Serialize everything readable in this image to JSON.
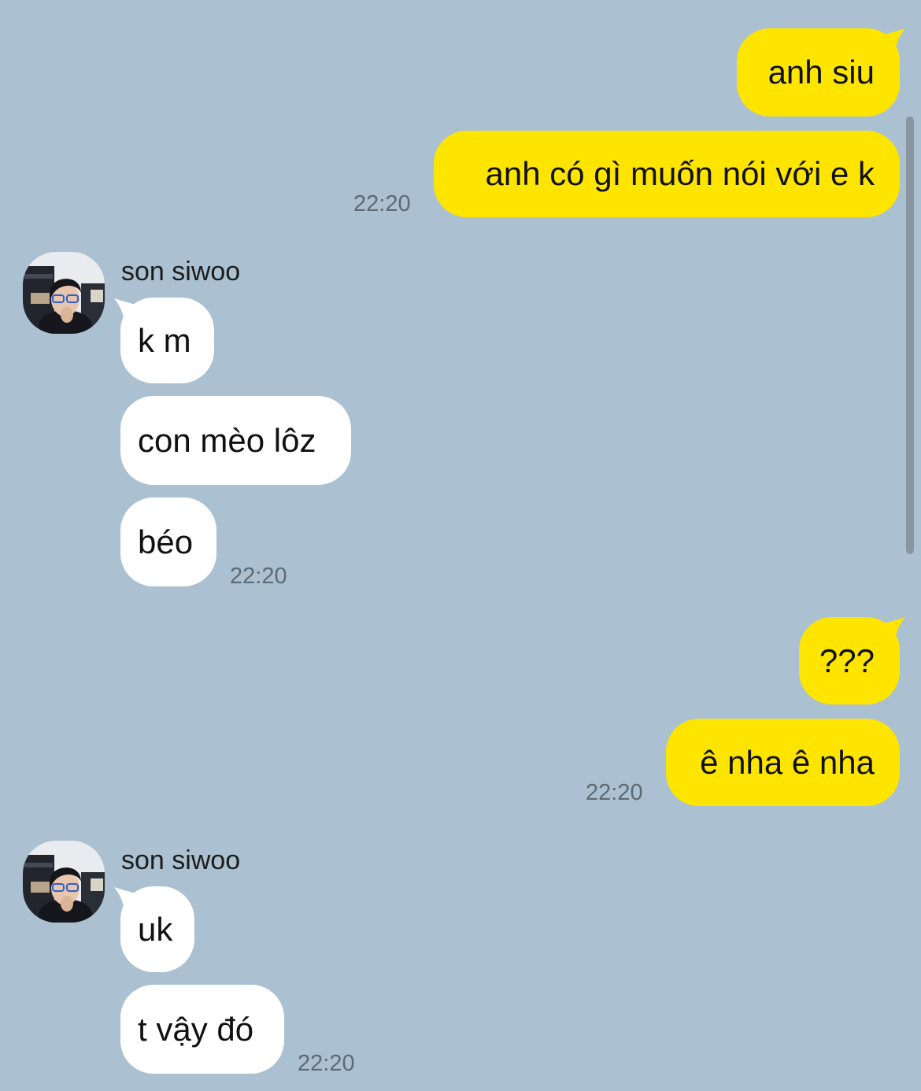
{
  "chat": {
    "sender_name": "son siwoo",
    "messages": [
      {
        "text": "anh siu"
      },
      {
        "text": "anh có gì muốn nói với e k"
      },
      {
        "text": "k m"
      },
      {
        "text": "con mèo lôz"
      },
      {
        "text": "béo"
      },
      {
        "text": "???"
      },
      {
        "text": "ê nha ê nha"
      },
      {
        "text": "uk"
      },
      {
        "text": "t vậy đó"
      }
    ],
    "timestamps": [
      "22:20",
      "22:20",
      "22:20",
      "22:20"
    ]
  },
  "colors": {
    "background": "#abc1d1",
    "outgoing_bubble": "#fee500",
    "incoming_bubble": "#ffffff",
    "timestamp": "#5d6a75"
  },
  "icons": {
    "avatar": "profile-photo",
    "scrollbar": "scrollbar-thumb"
  }
}
